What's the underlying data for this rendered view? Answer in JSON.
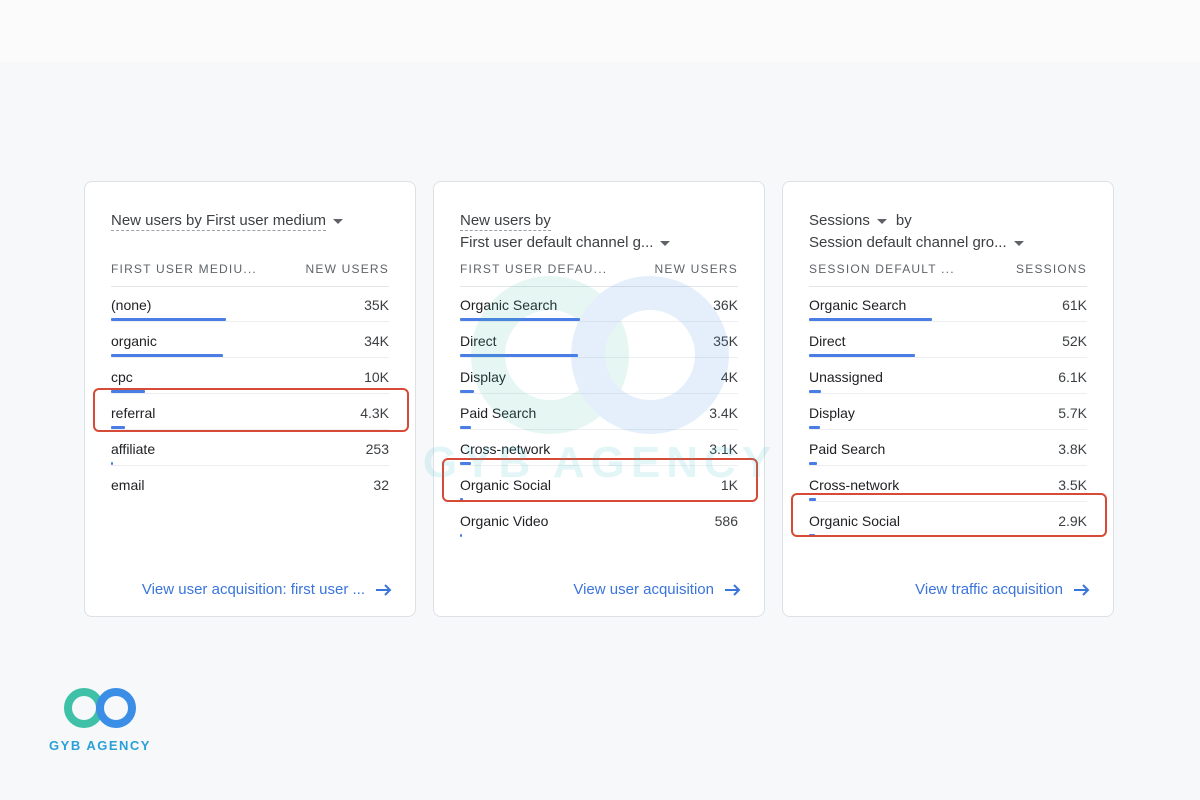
{
  "cards": [
    {
      "title": "New users by First user medium",
      "col_left": "FIRST USER MEDIU...",
      "col_right": "NEW USERS",
      "rows": [
        {
          "label": "(none)",
          "value": "35K",
          "bar": 0.41
        },
        {
          "label": "organic",
          "value": "34K",
          "bar": 0.4
        },
        {
          "label": "cpc",
          "value": "10K",
          "bar": 0.12
        },
        {
          "label": "referral",
          "value": "4.3K",
          "bar": 0.05
        },
        {
          "label": "affiliate",
          "value": "253",
          "bar": 0.003
        },
        {
          "label": "email",
          "value": "32",
          "bar": 0.0
        }
      ],
      "link": "View user acquisition: first user ..."
    },
    {
      "title_line1": "New users by",
      "title_line2": "First user default channel g...",
      "col_left": "FIRST USER DEFAU...",
      "col_right": "NEW USERS",
      "rows": [
        {
          "label": "Organic Search",
          "value": "36K",
          "bar": 0.43
        },
        {
          "label": "Direct",
          "value": "35K",
          "bar": 0.42
        },
        {
          "label": "Display",
          "value": "4K",
          "bar": 0.05
        },
        {
          "label": "Paid Search",
          "value": "3.4K",
          "bar": 0.04
        },
        {
          "label": "Cross-network",
          "value": "3.1K",
          "bar": 0.04
        },
        {
          "label": "Organic Social",
          "value": "1K",
          "bar": 0.012
        },
        {
          "label": "Organic Video",
          "value": "586",
          "bar": 0.007
        }
      ],
      "link": "View user acquisition"
    },
    {
      "title_a": "Sessions",
      "title_b": "by",
      "title_line2": "Session default channel gro...",
      "col_left": "SESSION DEFAULT ...",
      "col_right": "SESSIONS",
      "rows": [
        {
          "label": "Organic Search",
          "value": "61K",
          "bar": 0.44
        },
        {
          "label": "Direct",
          "value": "52K",
          "bar": 0.38
        },
        {
          "label": "Unassigned",
          "value": "6.1K",
          "bar": 0.044
        },
        {
          "label": "Display",
          "value": "5.7K",
          "bar": 0.041
        },
        {
          "label": "Paid Search",
          "value": "3.8K",
          "bar": 0.028
        },
        {
          "label": "Cross-network",
          "value": "3.5K",
          "bar": 0.025
        },
        {
          "label": "Organic Social",
          "value": "2.9K",
          "bar": 0.021
        }
      ],
      "link": "View traffic acquisition"
    }
  ],
  "brand": {
    "name": "GYB AGENCY",
    "accent": "#4a7de6",
    "highlight": "#d64b37",
    "link": "#3a75dc"
  }
}
